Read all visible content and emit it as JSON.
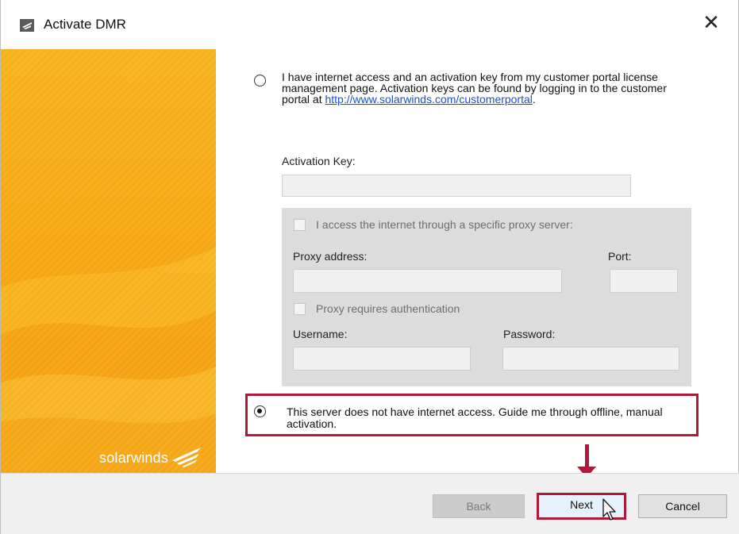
{
  "window": {
    "title": "Activate DMR"
  },
  "brand": {
    "logo_text": "solarwinds"
  },
  "online_option": {
    "text": "I have  internet access and an activation key from my customer portal license management page. Activation keys can be found by logging in to the customer portal at",
    "link": "http://www.solarwinds.com/customerportal",
    "suffix": ".",
    "selected": false
  },
  "activation_key": {
    "label": "Activation Key:",
    "value": ""
  },
  "proxy": {
    "checkbox_label": "I access the internet through a specific proxy server:",
    "address_label": "Proxy address:",
    "address_value": "",
    "port_label": "Port:",
    "port_value": "",
    "auth_label": "Proxy requires authentication",
    "username_label": "Username:",
    "username_value": "",
    "password_label": "Password:",
    "password_value": ""
  },
  "offline_option": {
    "text": "This server does not have internet access. Guide me through offline, manual activation.",
    "selected": true
  },
  "buttons": {
    "back": "Back",
    "next": "Next",
    "cancel": "Cancel"
  },
  "colors": {
    "highlight": "#b0183a",
    "brand_orange": "#f5a10a",
    "link": "#1a4fd6"
  }
}
